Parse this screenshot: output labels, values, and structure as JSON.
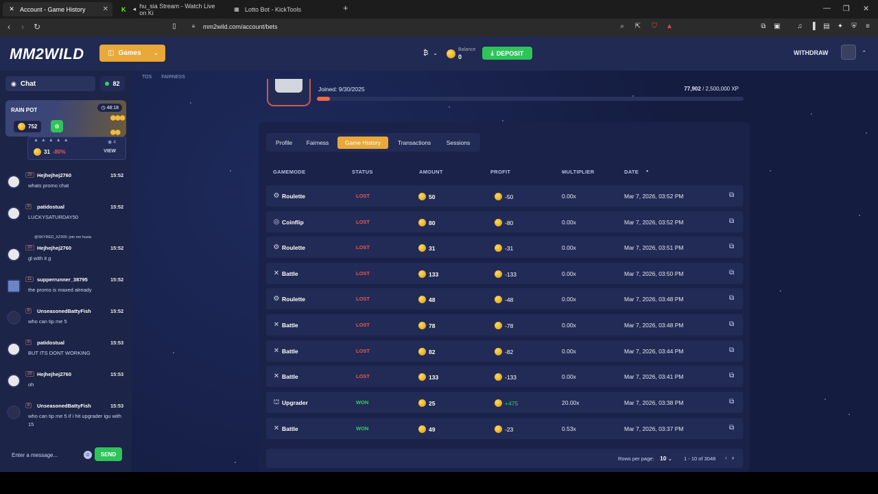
{
  "browser": {
    "tabs": [
      {
        "label": "Account - Game History",
        "icon": "mm2wild-icon",
        "active": true
      },
      {
        "label": "hu_sia Stream - Watch Live on Ki",
        "icon": "kick-icon",
        "active": false
      },
      {
        "label": "Lotto Bot - KickTools",
        "icon": "kicktools-icon",
        "active": false
      }
    ],
    "new_tab": "+",
    "url": "mm2wild.com/account/bets"
  },
  "header": {
    "logo": "MM2WILD",
    "games_label": "Games",
    "currency_symbol": "₿",
    "balance_label": "Balance",
    "balance_value": "0",
    "deposit_label": "DEPOSIT",
    "withdraw_label": "WITHDRAW"
  },
  "sidebar": {
    "chat_label": "Chat",
    "online_count": "82",
    "rain_pot": {
      "title": "RAIN POT",
      "timer": "48:18",
      "amount": "752"
    },
    "rain_sub": {
      "amount": "31",
      "percent": "-80%",
      "view": "VIEW",
      "count": "4"
    },
    "messages": [
      {
        "level": "20",
        "user": "Hejhejhej2760",
        "time": "15:52",
        "text": "whats promo chat"
      },
      {
        "level": "9",
        "user": "patidostual",
        "time": "15:52",
        "text": "LUCKYSATURDAY50"
      },
      {
        "level": "20",
        "user": "Hejhejhej2760",
        "time": "15:52",
        "text": "gl with it g",
        "reply": "@SKYRED_XZ309: join me husia"
      },
      {
        "level": "11",
        "user": "supperrunner_38795",
        "time": "15:52",
        "text": "the promo is maxed already"
      },
      {
        "level": "8",
        "user": "UnseasonedBattyFish",
        "time": "15:52",
        "text": "who can tip me 5"
      },
      {
        "level": "9",
        "user": "patidostual",
        "time": "15:53",
        "text": "BUT ITS DONT WORKING"
      },
      {
        "level": "20",
        "user": "Hejhejhej2760",
        "time": "15:53",
        "text": "oh"
      },
      {
        "level": "8",
        "user": "UnseasonedBattyFish",
        "time": "15:53",
        "text": "who can tip me 5 if i hit upgrader igu with 15"
      }
    ],
    "input_placeholder": "Enter a message...",
    "send_label": "SEND"
  },
  "main": {
    "top_links": [
      "TOS",
      "FAIRNESS"
    ],
    "profile": {
      "joined": "Joined: 9/30/2025",
      "xp_current": "77,902",
      "xp_total": "/ 2,500,000 XP",
      "xp_fraction": 0.031
    },
    "tabs": [
      {
        "label": "Profile",
        "active": false
      },
      {
        "label": "Fairness",
        "active": false
      },
      {
        "label": "Game History",
        "active": true
      },
      {
        "label": "Transactions",
        "active": false
      },
      {
        "label": "Sessions",
        "active": false
      }
    ],
    "columns": {
      "gamemode": "GAMEMODE",
      "status": "STATUS",
      "amount": "AMOUNT",
      "profit": "PROFIT",
      "multiplier": "MULTIPLIER",
      "date": "DATE"
    },
    "rows": [
      {
        "mode": "Roulette",
        "icon": "roulette-icon",
        "status": "LOST",
        "amount": "50",
        "profit": "-50",
        "multiplier": "0.00x",
        "date": "Mar 7, 2026, 03:52 PM"
      },
      {
        "mode": "Coinflip",
        "icon": "coinflip-icon",
        "status": "LOST",
        "amount": "80",
        "profit": "-80",
        "multiplier": "0.00x",
        "date": "Mar 7, 2026, 03:52 PM"
      },
      {
        "mode": "Roulette",
        "icon": "roulette-icon",
        "status": "LOST",
        "amount": "31",
        "profit": "-31",
        "multiplier": "0.00x",
        "date": "Mar 7, 2026, 03:51 PM"
      },
      {
        "mode": "Battle",
        "icon": "battle-icon",
        "status": "LOST",
        "amount": "133",
        "profit": "-133",
        "multiplier": "0.00x",
        "date": "Mar 7, 2026, 03:50 PM"
      },
      {
        "mode": "Roulette",
        "icon": "roulette-icon",
        "status": "LOST",
        "amount": "48",
        "profit": "-48",
        "multiplier": "0.00x",
        "date": "Mar 7, 2026, 03:48 PM"
      },
      {
        "mode": "Battle",
        "icon": "battle-icon",
        "status": "LOST",
        "amount": "78",
        "profit": "-78",
        "multiplier": "0.00x",
        "date": "Mar 7, 2026, 03:48 PM"
      },
      {
        "mode": "Battle",
        "icon": "battle-icon",
        "status": "LOST",
        "amount": "82",
        "profit": "-82",
        "multiplier": "0.00x",
        "date": "Mar 7, 2026, 03:44 PM"
      },
      {
        "mode": "Battle",
        "icon": "battle-icon",
        "status": "LOST",
        "amount": "133",
        "profit": "-133",
        "multiplier": "0.00x",
        "date": "Mar 7, 2026, 03:41 PM"
      },
      {
        "mode": "Upgrader",
        "icon": "upgrader-icon",
        "status": "WON",
        "amount": "25",
        "profit": "+475",
        "multiplier": "20.00x",
        "date": "Mar 7, 2026, 03:38 PM"
      },
      {
        "mode": "Battle",
        "icon": "battle-icon",
        "status": "WON",
        "amount": "49",
        "profit": "-23",
        "multiplier": "0.53x",
        "date": "Mar 7, 2026, 03:37 PM"
      }
    ],
    "pager": {
      "rows_per_page_label": "Rows per page:",
      "rows_per_page": "10",
      "range": "1 - 10 of 3048"
    }
  },
  "colors": {
    "accent": "#e8a83a",
    "won": "#2fd067",
    "lost": "#e25b5b",
    "deposit": "#2fc45a",
    "bg": "#141c40"
  }
}
